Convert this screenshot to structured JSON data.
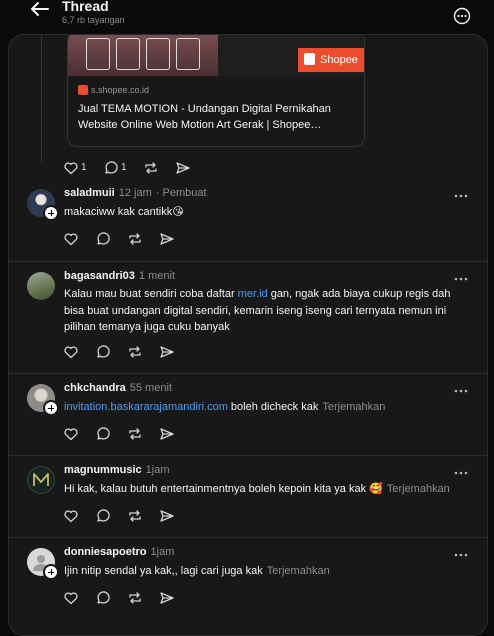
{
  "header": {
    "title": "Thread",
    "views": "6,7 rb tayangan"
  },
  "card": {
    "shopee_label": "Shopee",
    "domain": "s.shopee.co.id",
    "title": "Jual TEMA MOTION - Undangan Digital Pernikahan Website Online Web Motion Art Gerak | Shopee…"
  },
  "root_actions": {
    "likes": "1",
    "replies": "1"
  },
  "posts": [
    {
      "username": "saladmuii",
      "time": "12 jam",
      "role": "· Pembuat",
      "text": "makaciww kak cantikk😘"
    },
    {
      "username": "bagasandri03",
      "time": "1 menit",
      "text_before": "Kalau mau buat sendiri coba daftar ",
      "link": "mer.id",
      "text_after": " gan, ngak ada biaya cukup regis dah bisa buat undangan digital sendiri, kemarin iseng iseng cari ternyata nemun ini pilihan temanya juga cuku banyak"
    },
    {
      "username": "chkchandra",
      "time": "55 menit",
      "link": "invitation.baskararajamandiri.com",
      "text_after": " boleh dicheck kak",
      "translate": "Terjemahkan"
    },
    {
      "username": "magnummusic",
      "time": "1jam",
      "text": "Hi kak, kalau butuh entertainmentnya boleh kepoin kita ya kak 🥰",
      "translate": "Terjemahkan"
    },
    {
      "username": "donniesapoetro",
      "time": "1jam",
      "text": "Ijin nitip sendal ya kak,, lagi cari juga kak",
      "translate": "Terjemahkan"
    }
  ],
  "colors": {
    "background": "#0a0a0a",
    "panel": "#181818",
    "link": "#4f9ef7",
    "shopee": "#ee4d2d"
  }
}
